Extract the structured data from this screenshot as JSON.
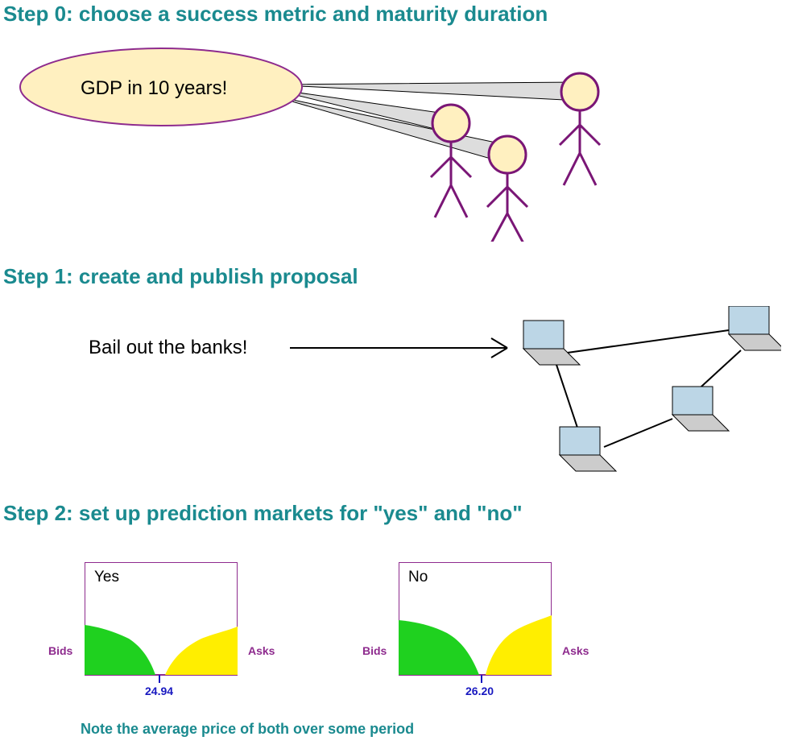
{
  "step0": {
    "heading": "Step 0: choose a success metric and maturity duration",
    "bubble": "GDP in 10 years!"
  },
  "step1": {
    "heading": "Step 1: create and publish proposal",
    "proposal": "Bail out the banks!"
  },
  "step2": {
    "heading": "Step 2: set up prediction markets for \"yes\" and \"no\"",
    "yesChart": {
      "title": "Yes",
      "bidsLabel": "Bids",
      "asksLabel": "Asks",
      "price": "24.94"
    },
    "noChart": {
      "title": "No",
      "bidsLabel": "Bids",
      "asksLabel": "Asks",
      "price": "26.20"
    },
    "note": "Note the average price of both over some period"
  }
}
